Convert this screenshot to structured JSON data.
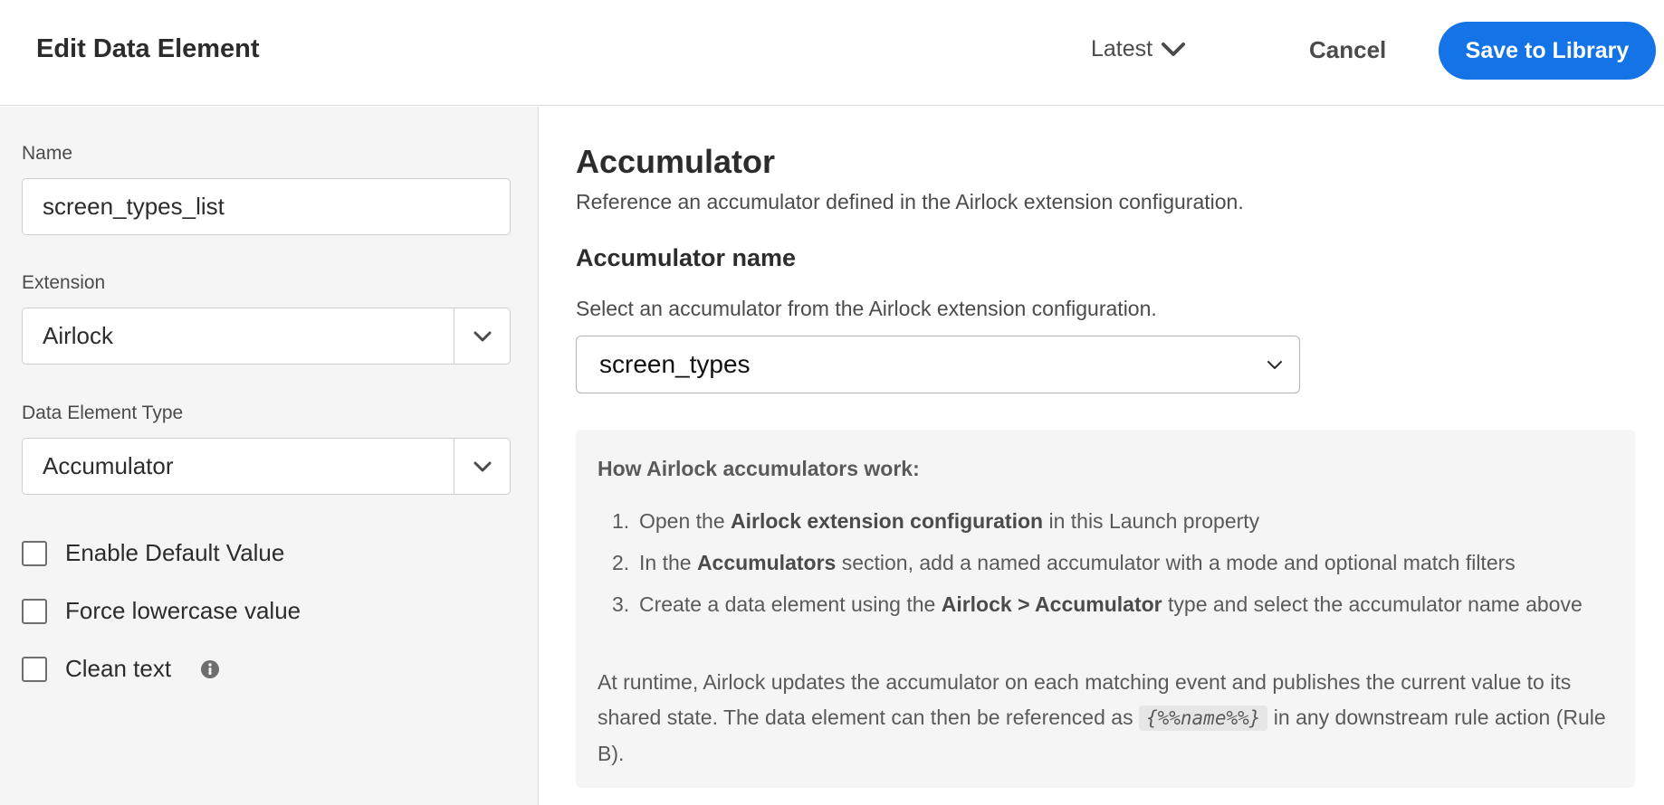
{
  "header": {
    "title": "Edit Data Element",
    "version_label": "Latest",
    "cancel_label": "Cancel",
    "save_label": "Save to Library"
  },
  "form": {
    "name_label": "Name",
    "name_value": "screen_types_list",
    "extension_label": "Extension",
    "extension_value": "Airlock",
    "type_label": "Data Element Type",
    "type_value": "Accumulator",
    "checkboxes": [
      {
        "label": "Enable Default Value",
        "checked": false
      },
      {
        "label": "Force lowercase value",
        "checked": false
      },
      {
        "label": "Clean text",
        "checked": false
      }
    ]
  },
  "config": {
    "title": "Accumulator",
    "description": "Reference an accumulator defined in the Airlock extension configuration.",
    "name_heading": "Accumulator name",
    "name_description": "Select an accumulator from the Airlock extension configuration.",
    "selected_accumulator": "screen_types",
    "info": {
      "heading": "How Airlock accumulators work:",
      "steps": [
        {
          "num": "1.",
          "pre": "Open the ",
          "bold": "Airlock extension configuration",
          "post": " in this Launch property"
        },
        {
          "num": "2.",
          "pre": "In the ",
          "bold": "Accumulators",
          "post": " section, add a named accumulator with a mode and optional match filters"
        },
        {
          "num": "3.",
          "pre": "Create a data element using the ",
          "bold": "Airlock > Accumulator",
          "post": " type and select the accumulator name above"
        }
      ],
      "runtime_pre": "At runtime, Airlock updates the accumulator on each matching event and publishes the current value to its shared state. The data element can then be referenced as ",
      "runtime_code": "{%%name%%}",
      "runtime_post": " in any downstream rule action (Rule B)."
    }
  },
  "colors": {
    "accent": "#1473e6",
    "panel_bg": "#f5f5f5"
  }
}
